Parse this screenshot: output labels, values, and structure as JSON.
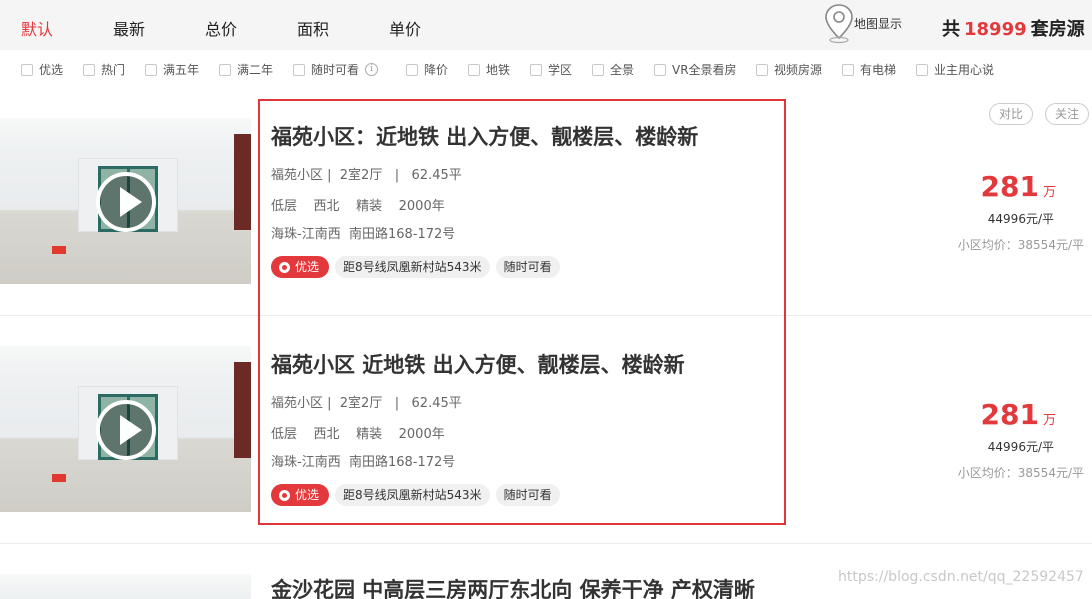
{
  "sort_tabs": [
    "默认",
    "最新",
    "总价",
    "面积",
    "单价"
  ],
  "map_button": {
    "label": "地图显示",
    "icon": "map-pin-icon"
  },
  "total": {
    "prefix": "共",
    "count": "18999",
    "suffix": "套房源"
  },
  "filters": [
    {
      "label": "优选"
    },
    {
      "label": "热门"
    },
    {
      "label": "满五年"
    },
    {
      "label": "满二年"
    },
    {
      "label": "随时可看"
    },
    {
      "label": "降价"
    },
    {
      "label": "地铁"
    },
    {
      "label": "学区"
    },
    {
      "label": "全景"
    },
    {
      "label": "VR全景看房"
    },
    {
      "label": "视频房源"
    },
    {
      "label": "有电梯"
    },
    {
      "label": "业主用心说"
    }
  ],
  "actions": {
    "compare": "对比",
    "follow": "关注"
  },
  "listings": [
    {
      "title": "福苑小区：近地铁 出入方便、靓楼层、楼龄新",
      "community": "福苑小区 |",
      "layout": "2室2厅",
      "sep": "|",
      "area": "62.45平",
      "floor": "低层",
      "orientation": "西北",
      "decoration": "精装",
      "year": "2000年",
      "location": "海珠-江南西",
      "address": "南田路168-172号",
      "tags": [
        "优选",
        "距8号线凤凰新村站543米",
        "随时可看"
      ],
      "price": "281",
      "price_unit": "万",
      "unit_price": "44996元/平",
      "avg_price": "小区均价：38554元/平"
    },
    {
      "title": "福苑小区 近地铁 出入方便、靓楼层、楼龄新",
      "community": "福苑小区 |",
      "layout": "2室2厅",
      "sep": "|",
      "area": "62.45平",
      "floor": "低层",
      "orientation": "西北",
      "decoration": "精装",
      "year": "2000年",
      "location": "海珠-江南西",
      "address": "南田路168-172号",
      "tags": [
        "优选",
        "距8号线凤凰新村站543米",
        "随时可看"
      ],
      "price": "281",
      "price_unit": "万",
      "unit_price": "44996元/平",
      "avg_price": "小区均价：38554元/平"
    },
    {
      "title": "金沙花园 中高层三房两厅东北向 保养干净 产权清晰"
    }
  ],
  "watermark": "https://blog.csdn.net/qq_22592457",
  "colors": {
    "accent": "#e4393c",
    "highlight_border": "#e0363b"
  }
}
